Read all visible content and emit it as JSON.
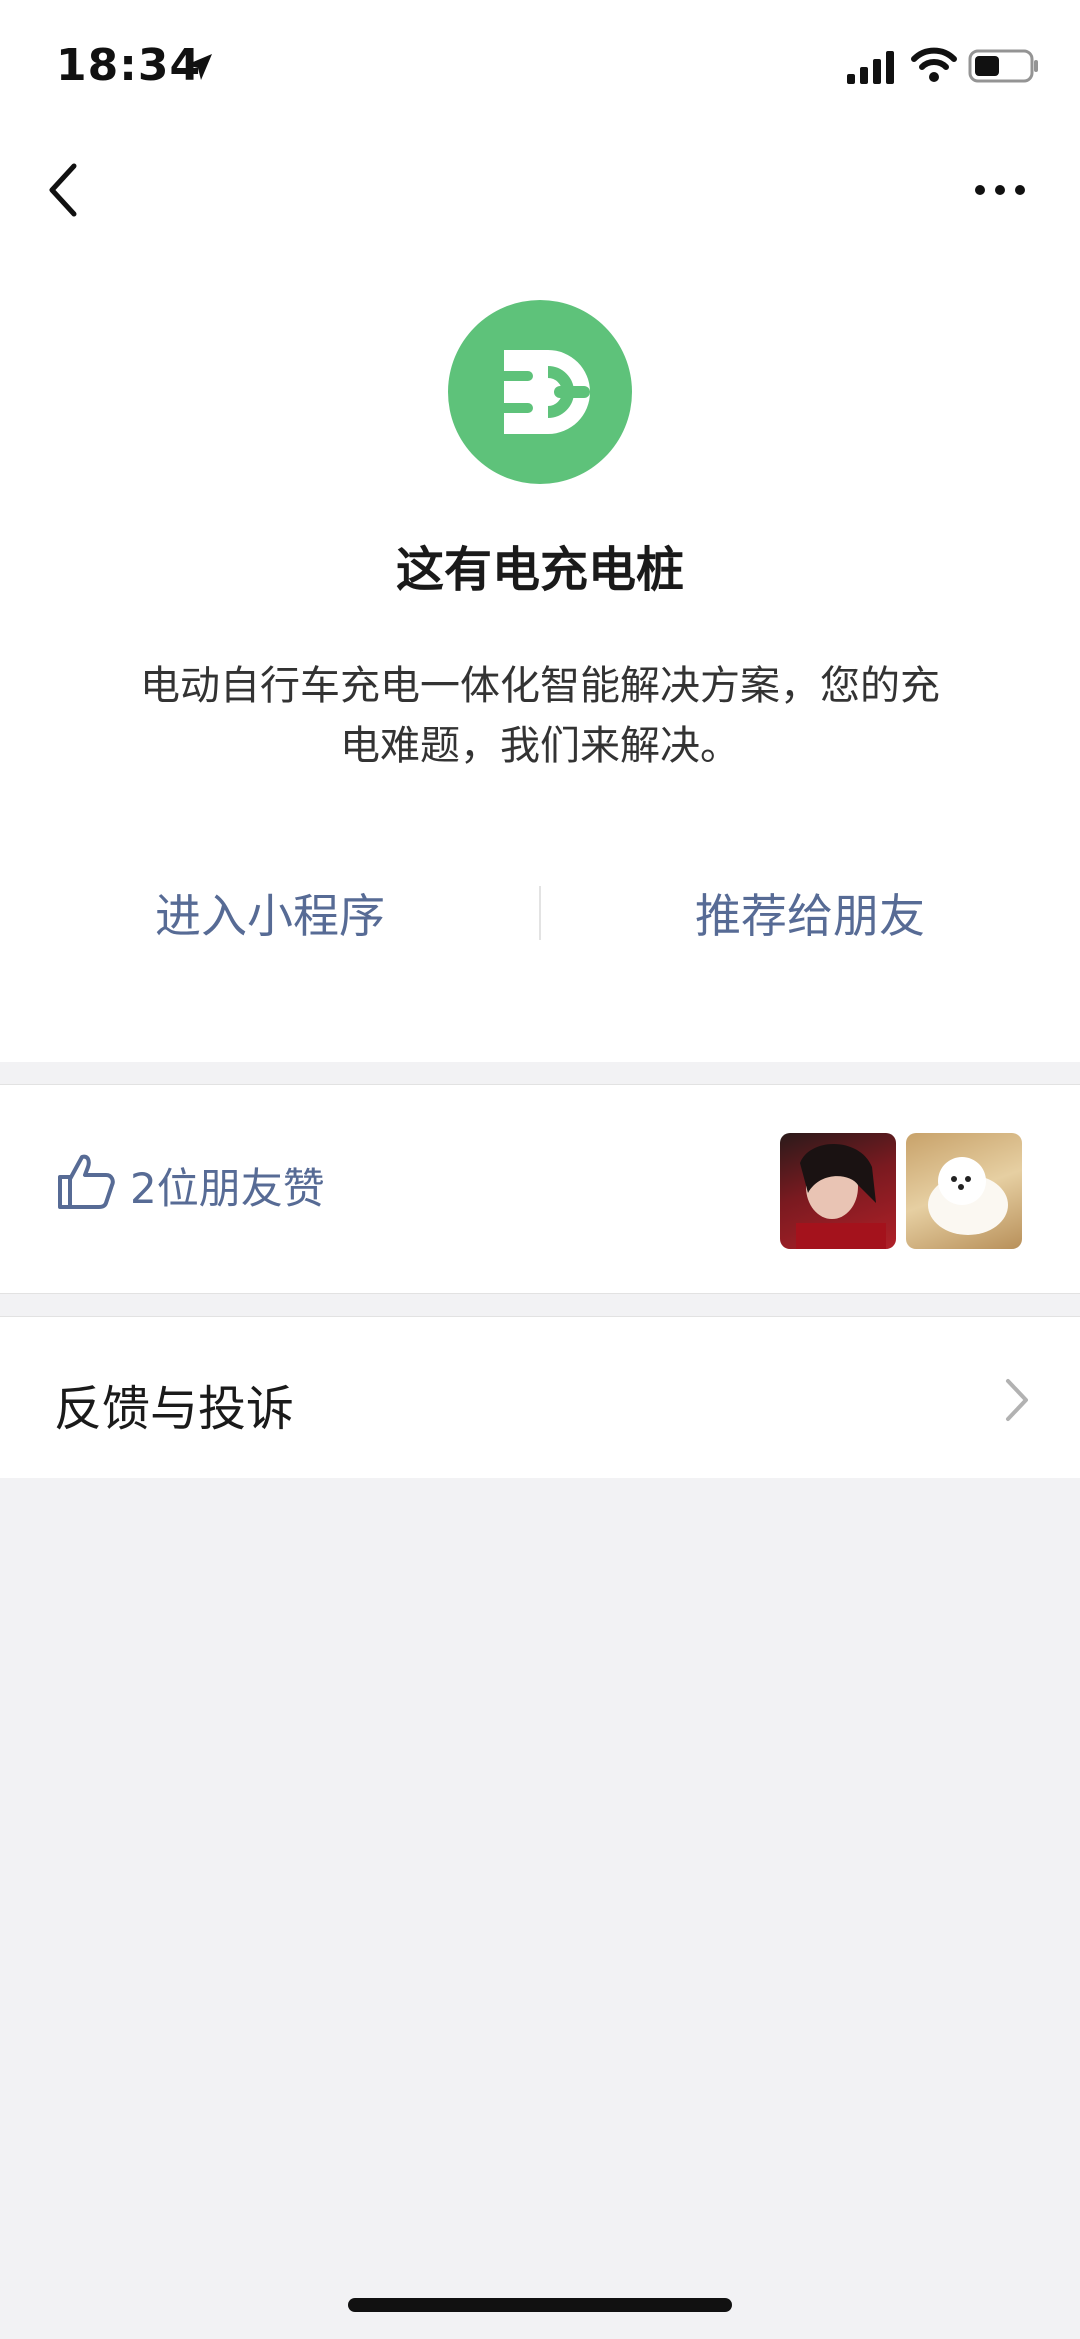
{
  "status_bar": {
    "time": "18:34"
  },
  "app": {
    "name": "这有电充电桩",
    "description": "电动自行车充电一体化智能解决方案，您的充电难题，我们来解决。",
    "brand_color": "#5ec27a"
  },
  "actions": {
    "enter_label": "进入小程序",
    "share_label": "推荐给朋友",
    "link_color": "#576b95"
  },
  "likes": {
    "text": "2位朋友赞",
    "avatars": [
      "friend-avatar-1",
      "friend-avatar-2"
    ]
  },
  "feedback": {
    "label": "反馈与投诉"
  }
}
